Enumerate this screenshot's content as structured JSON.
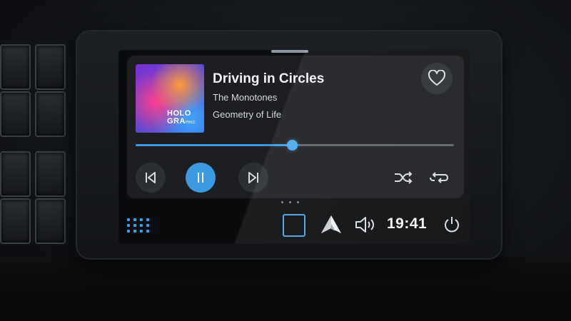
{
  "track": {
    "title": "Driving in Circles",
    "artist": "The Monotones",
    "album": "Geometry of Life",
    "progress": 0.49
  },
  "album_art": {
    "line1": "HOLO",
    "line2": "GRA",
    "line2_small": "PHIC"
  },
  "clock": {
    "time": "19:41"
  },
  "icons": {
    "favorite": "heart-icon",
    "previous": "skip-previous-icon",
    "play_pause": "pause-icon",
    "next": "skip-next-icon",
    "shuffle": "shuffle-icon",
    "repeat": "repeat-icon",
    "apps": "app-grid-icon",
    "home": "square-home-icon",
    "android_auto": "android-auto-icon",
    "volume": "volume-icon",
    "power": "power-icon"
  },
  "colors": {
    "accent": "#3a9be8",
    "card_bg": "#1c1e22",
    "screen_bg": "#0b0c0e",
    "text_primary": "#f2f3f5"
  }
}
